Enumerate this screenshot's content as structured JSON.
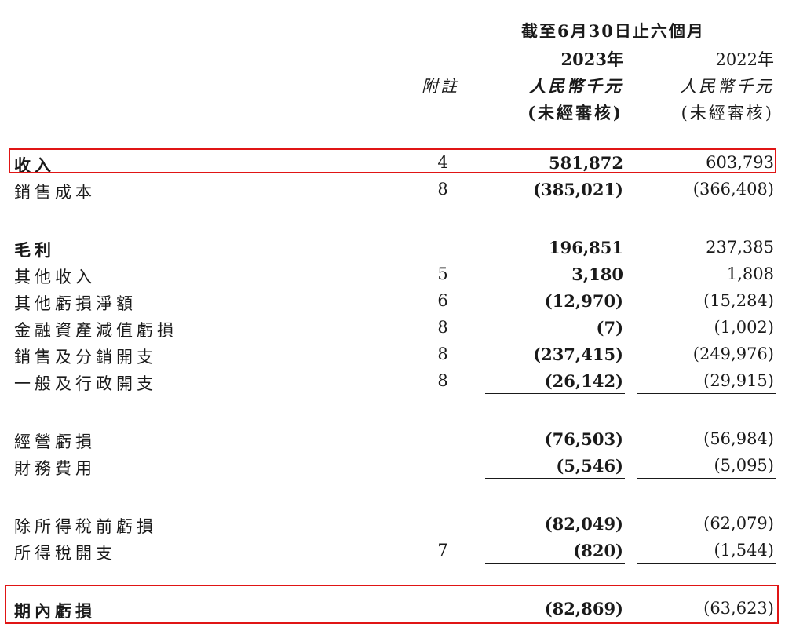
{
  "header": {
    "period": "截至6月30日止六個月",
    "year_current": "2023年",
    "year_prior": "2022年",
    "note_label": "附註",
    "currency_current": "人民幣千元",
    "currency_prior": "人民幣千元",
    "audit_current": "(未經審核)",
    "audit_prior": "(未經審核)"
  },
  "rows": [
    {
      "label": "收入",
      "note": "4",
      "v2023": "581,872",
      "v2022": "603,793",
      "bold": true
    },
    {
      "label": "銷售成本",
      "note": "8",
      "v2023": "(385,021)",
      "v2022": "(366,408)"
    },
    {
      "label": "毛利",
      "note": "",
      "v2023": "196,851",
      "v2022": "237,385",
      "bold": true
    },
    {
      "label": "其他收入",
      "note": "5",
      "v2023": "3,180",
      "v2022": "1,808"
    },
    {
      "label": "其他虧損淨額",
      "note": "6",
      "v2023": "(12,970)",
      "v2022": "(15,284)"
    },
    {
      "label": "金融資產減值虧損",
      "note": "8",
      "v2023": "(7)",
      "v2022": "(1,002)"
    },
    {
      "label": "銷售及分銷開支",
      "note": "8",
      "v2023": "(237,415)",
      "v2022": "(249,976)"
    },
    {
      "label": "一般及行政開支",
      "note": "8",
      "v2023": "(26,142)",
      "v2022": "(29,915)"
    },
    {
      "label": "經營虧損",
      "note": "",
      "v2023": "(76,503)",
      "v2022": "(56,984)"
    },
    {
      "label": "財務費用",
      "note": "",
      "v2023": "(5,546)",
      "v2022": "(5,095)"
    },
    {
      "label": "除所得稅前虧損",
      "note": "",
      "v2023": "(82,049)",
      "v2022": "(62,079)"
    },
    {
      "label": "所得稅開支",
      "note": "7",
      "v2023": "(820)",
      "v2022": "(1,544)"
    },
    {
      "label": "期內虧損",
      "note": "",
      "v2023": "(82,869)",
      "v2022": "(63,623)",
      "bold": true
    }
  ],
  "colors": {
    "highlight": "#e01515",
    "text": "#1a1a1a"
  }
}
